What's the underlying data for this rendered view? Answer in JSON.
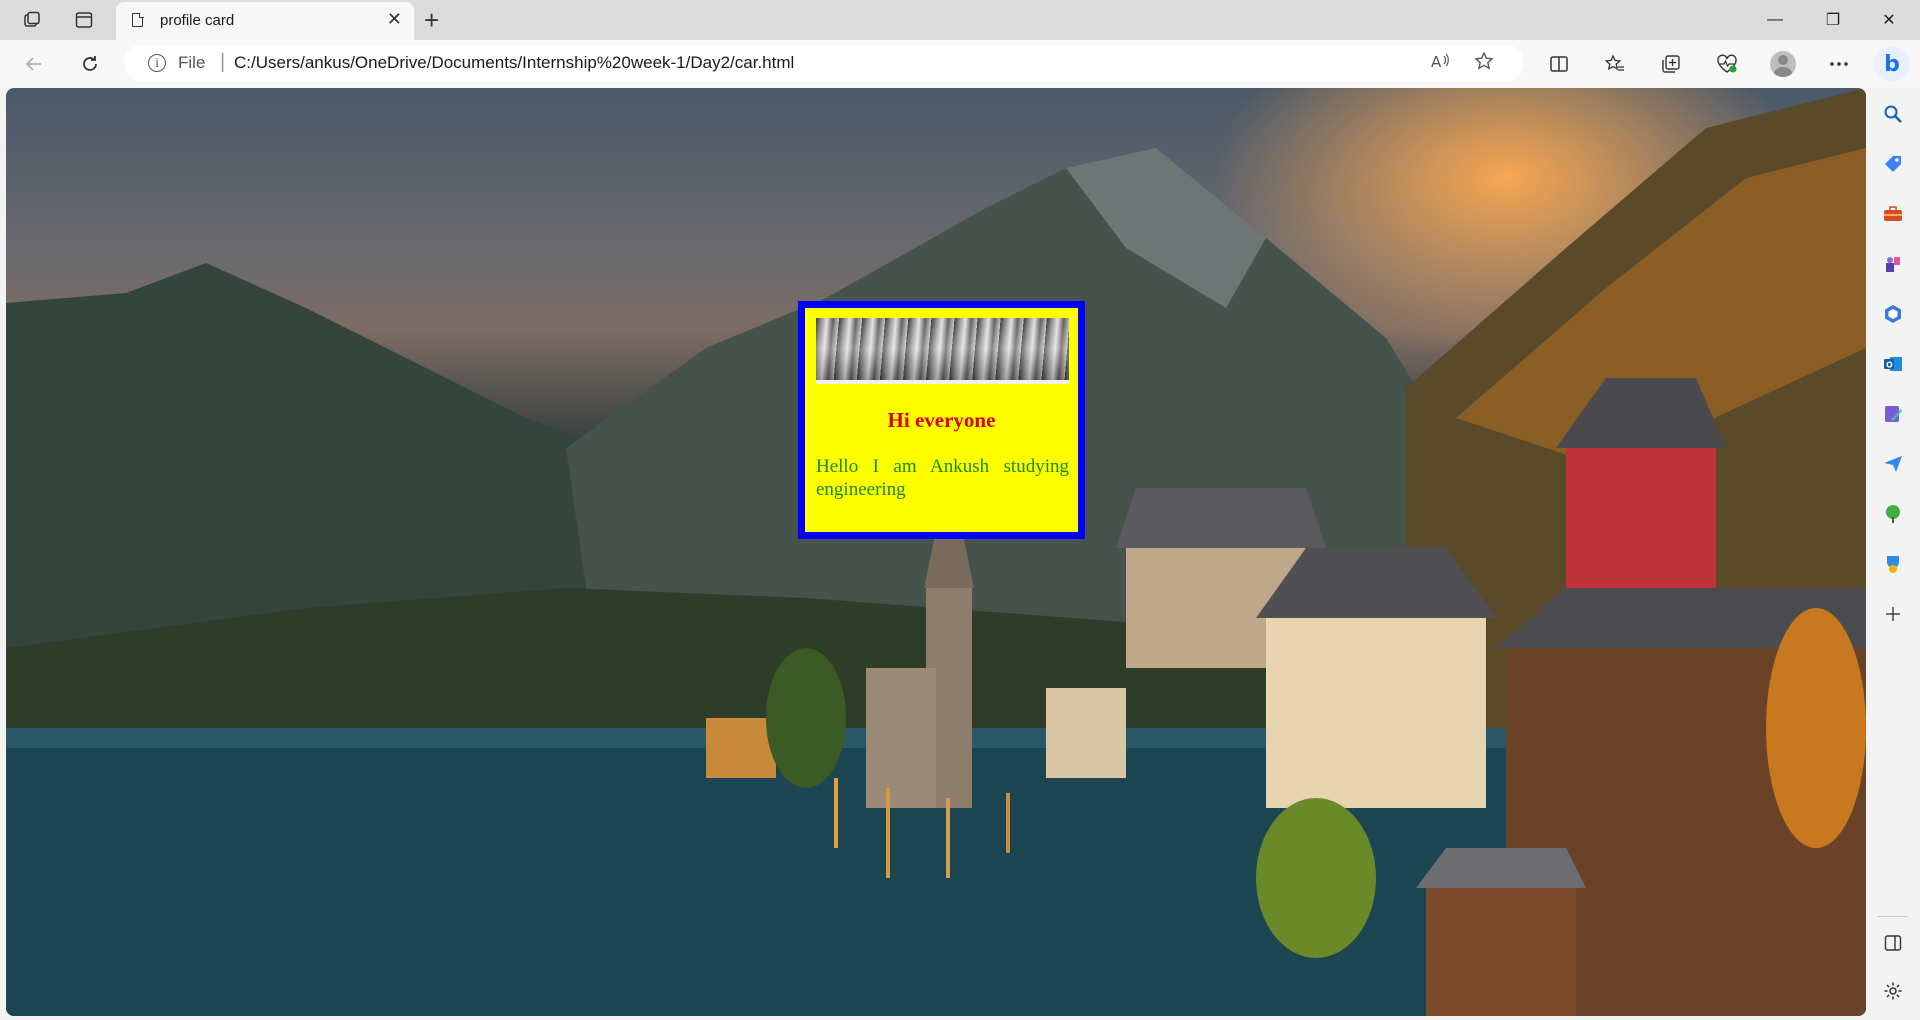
{
  "tab": {
    "title": "profile card",
    "close_symbol": "✕",
    "new_tab_symbol": "+"
  },
  "window_controls": {
    "minimize": "—",
    "maximize": "❐",
    "close": "✕"
  },
  "address_bar": {
    "scheme_label": "File",
    "separator": "|",
    "url": "C:/Users/ankus/OneDrive/Documents/Internship%20week-1/Day2/car.html"
  },
  "toolbar_icons": {
    "back": "back-arrow-icon",
    "refresh": "refresh-icon",
    "read_aloud": "read-aloud-icon",
    "favorite": "star-icon",
    "split_screen": "split-screen-icon",
    "favorites": "favorites-icon",
    "collections": "collections-icon",
    "browser_essentials": "heart-pulse-icon",
    "profile": "profile-icon",
    "more": "more-icon",
    "copilot": "copilot-icon"
  },
  "card": {
    "heading": "Hi everyone",
    "text": "Hello I am Ankush studying engineering",
    "background_color": "#ffff00",
    "border_color": "#0000ff",
    "heading_color": "#e00000",
    "text_color": "#1a8a1a"
  },
  "sidebar_icons": [
    "search-icon",
    "tag-icon",
    "toolbox-icon",
    "games-icon",
    "office-icon",
    "outlook-icon",
    "designer-icon",
    "send-icon",
    "tree-icon",
    "drop-icon",
    "add-icon",
    "sidebar-toggle-icon",
    "settings-icon"
  ]
}
